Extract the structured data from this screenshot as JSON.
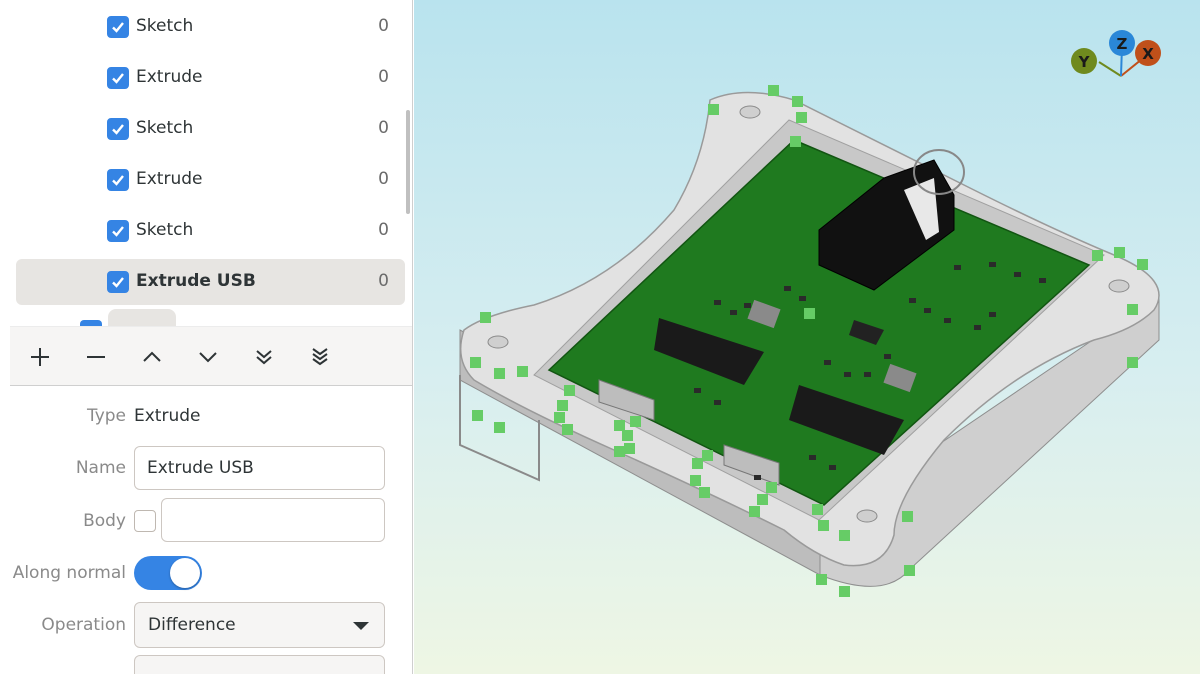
{
  "tree": {
    "items": [
      {
        "label": "Sketch",
        "count": "0",
        "checked": true
      },
      {
        "label": "Extrude",
        "count": "0",
        "checked": true
      },
      {
        "label": "Sketch",
        "count": "0",
        "checked": true
      },
      {
        "label": "Extrude",
        "count": "0",
        "checked": true
      },
      {
        "label": "Sketch",
        "count": "0",
        "checked": true
      },
      {
        "label": "Extrude USB",
        "count": "0",
        "checked": true,
        "selected": true
      }
    ]
  },
  "toolbar": {
    "buttons": [
      {
        "name": "add-icon"
      },
      {
        "name": "remove-icon"
      },
      {
        "name": "move-up-icon"
      },
      {
        "name": "move-down-icon"
      },
      {
        "name": "move-to-bottom-icon"
      },
      {
        "name": "move-to-end-icon"
      }
    ]
  },
  "properties": {
    "type_label": "Type",
    "type_value": "Extrude",
    "name_label": "Name",
    "name_value": "Extrude USB",
    "body_label": "Body",
    "body_value": "",
    "along_normal_label": "Along normal",
    "along_normal_on": true,
    "operation_label": "Operation",
    "operation_value": "Difference"
  },
  "axes": {
    "x": "X",
    "y": "Y",
    "z": "Z",
    "x_color": "#c0501a",
    "y_color": "#6f8a1e",
    "z_color": "#2a87d8"
  },
  "colors": {
    "accent": "#3584e4",
    "pcb": "#1f7a1f",
    "handle": "#66cc66"
  }
}
